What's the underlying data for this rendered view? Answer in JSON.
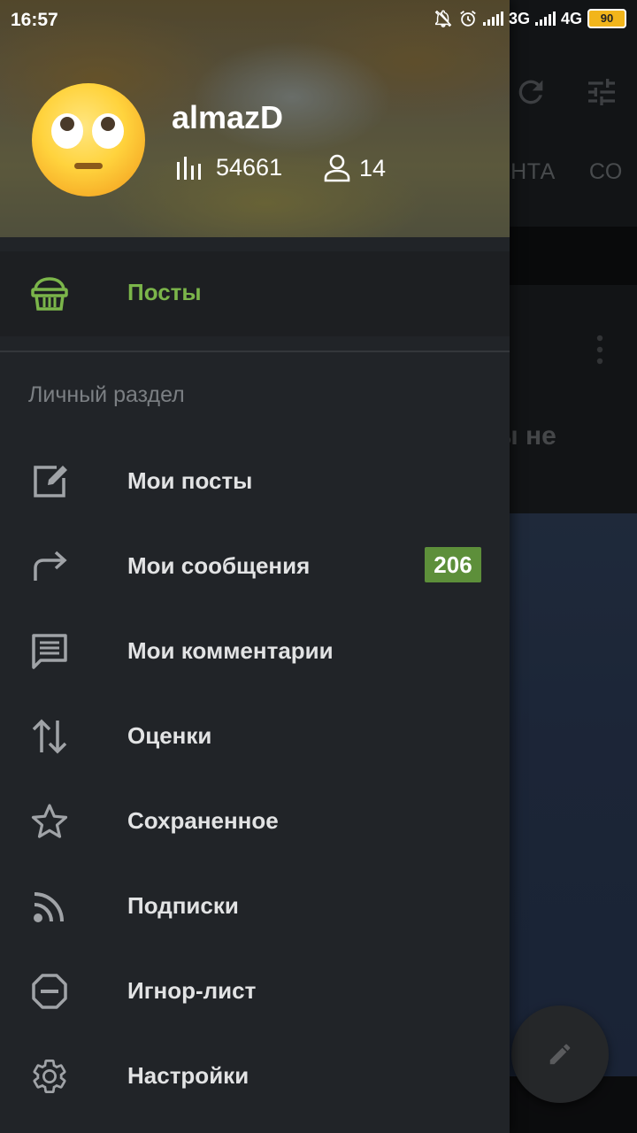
{
  "status_bar": {
    "time": "16:57",
    "network_1": "3G",
    "network_2": "4G",
    "battery": "90"
  },
  "background": {
    "tabs": [
      "ЕНТА",
      "СО"
    ],
    "post_title_fragment": "ы не"
  },
  "profile": {
    "username": "almazD",
    "rating": "54661",
    "subscribers": "14"
  },
  "menu": {
    "posts": {
      "label": "Посты",
      "icon": "basket-icon"
    },
    "section_title": "Личный раздел",
    "items": [
      {
        "label": "Мои посты",
        "icon": "edit-icon"
      },
      {
        "label": "Мои сообщения",
        "icon": "forward-arrow-icon",
        "badge": "206"
      },
      {
        "label": "Мои комментарии",
        "icon": "comment-icon"
      },
      {
        "label": "Оценки",
        "icon": "up-down-arrows-icon"
      },
      {
        "label": "Сохраненное",
        "icon": "star-icon"
      },
      {
        "label": "Подписки",
        "icon": "rss-icon"
      },
      {
        "label": "Игнор-лист",
        "icon": "block-icon"
      },
      {
        "label": "Настройки",
        "icon": "gear-icon"
      }
    ]
  },
  "colors": {
    "accent": "#7bb54a",
    "badge": "#5d8f3a",
    "drawer": "#212428"
  }
}
